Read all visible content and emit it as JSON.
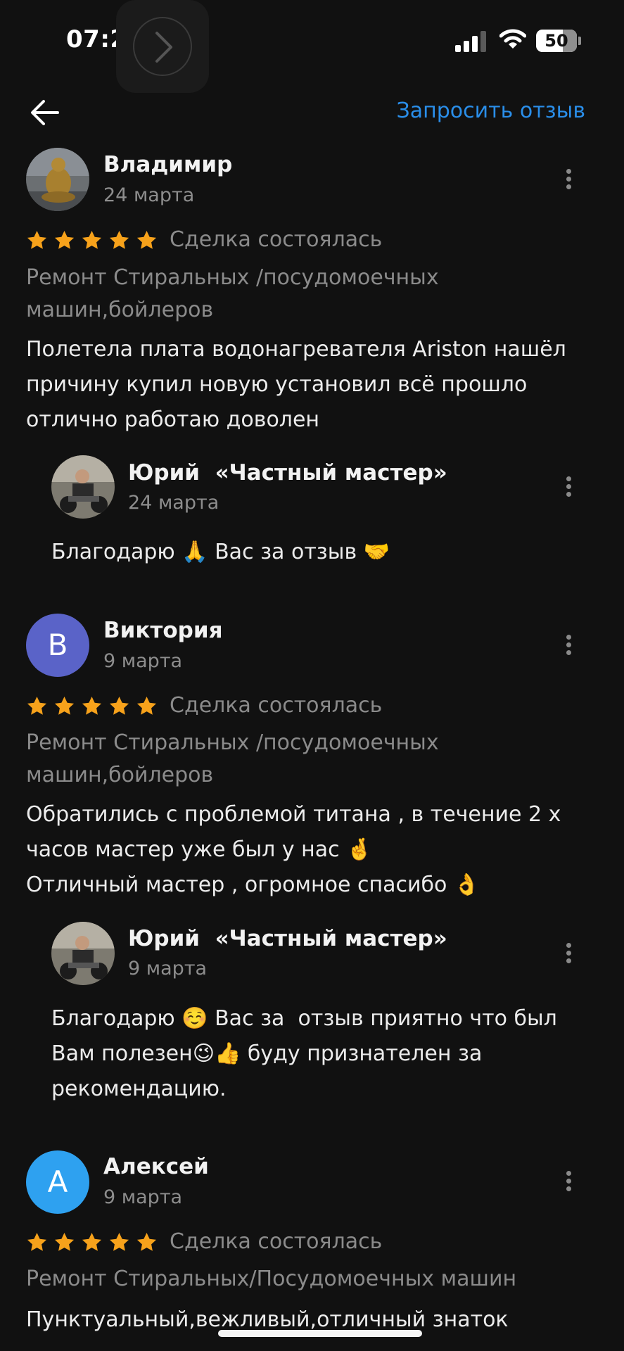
{
  "status_bar": {
    "time": "07:25",
    "battery": "50",
    "icons": [
      "forward-chevron-icon",
      "signal-icon",
      "wifi-icon",
      "battery-icon"
    ]
  },
  "header": {
    "back_icon": "arrow-left-icon",
    "request_label": "Запросить отзыв"
  },
  "colors": {
    "accent": "#2a8ee9",
    "star": "#f7a21b",
    "avatar_v": "#5a63c8",
    "avatar_a": "#2ea1f0",
    "background": "#111111"
  },
  "reviews": [
    {
      "author": "Владимир",
      "date": "24 марта",
      "rating": 5,
      "status": "Сделка состоялась",
      "service": "Ремонт Стиральных /посудомоечных машин,бойлеров",
      "text": "Полетела плата водонагревателя Ariston нашёл причину купил новую установил всё прошло отлично работаю доволен",
      "reply": {
        "author": "Юрий  «Частный мастер»",
        "date": "24 марта",
        "text": "Благодарю 🙏 Вас за отзыв 🤝"
      }
    },
    {
      "author": "Виктория",
      "avatar_letter": "В",
      "date": "9 марта",
      "rating": 5,
      "status": "Сделка состоялась",
      "service": "Ремонт Стиральных /посудомоечных машин,бойлеров",
      "text": "Обратились с проблемой титана , в течение 2 х часов мастер уже был у нас 🤞\nОтличный мастер , огромное спасибо 👌",
      "reply": {
        "author": "Юрий  «Частный мастер»",
        "date": "9 марта",
        "text": "Благодарю ☺️ Вас за  отзыв приятно что был Вам полезен😉👍 буду признателен за рекомендацию."
      }
    },
    {
      "author": "Алексей",
      "avatar_letter": "А",
      "date": "9 марта",
      "rating": 5,
      "status": "Сделка состоялась",
      "service": "Ремонт Стиральных/Посудомоечных машин",
      "text": "Пунктуальный,вежливый,отличный знаток"
    }
  ]
}
